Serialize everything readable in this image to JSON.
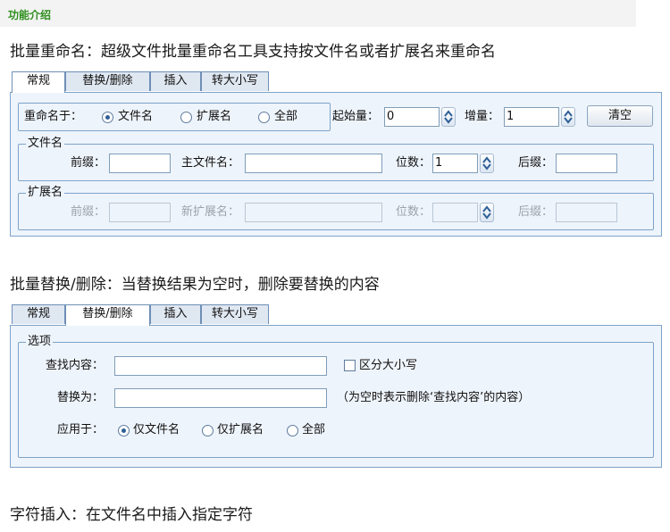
{
  "header": {
    "title": "功能介绍"
  },
  "section1": {
    "description": "批量重命名：超级文件批量重命名工具支持按文件名或者扩展名来重命名",
    "tabs": [
      {
        "label": "常规",
        "active": true
      },
      {
        "label": "替换/删除",
        "active": false
      },
      {
        "label": "插入",
        "active": false
      },
      {
        "label": "转大小写",
        "active": false
      }
    ],
    "rename_on": {
      "label": "重命名于：",
      "options": [
        "文件名",
        "扩展名",
        "全部"
      ],
      "selected": "文件名"
    },
    "start": {
      "label": "起始量：",
      "value": "0"
    },
    "increment": {
      "label": "增量：",
      "value": "1"
    },
    "clear_button": "清空",
    "filename_group": {
      "title": "文件名",
      "prefix_label": "前缀：",
      "prefix_value": "",
      "main_label": "主文件名：",
      "main_value": "",
      "digits_label": "位数：",
      "digits_value": "1",
      "suffix_label": "后缀：",
      "suffix_value": ""
    },
    "ext_group": {
      "title": "扩展名",
      "prefix_label": "前缀：",
      "prefix_value": "",
      "main_label": "新扩展名：",
      "main_value": "",
      "digits_label": "位数：",
      "digits_value": "",
      "suffix_label": "后缀：",
      "suffix_value": ""
    }
  },
  "section2": {
    "description": "批量替换/删除：当替换结果为空时，删除要替换的内容",
    "tabs": [
      {
        "label": "常规",
        "active": false
      },
      {
        "label": "替换/删除",
        "active": true
      },
      {
        "label": "插入",
        "active": false
      },
      {
        "label": "转大小写",
        "active": false
      }
    ],
    "options_group": {
      "title": "选项",
      "find_label": "查找内容：",
      "find_value": "",
      "case_label": "区分大小写",
      "case_checked": false,
      "replace_label": "替换为：",
      "replace_value": "",
      "replace_hint": "（为空时表示删除‘查找内容’的内容）",
      "apply_label": "应用于：",
      "apply_options": [
        "仅文件名",
        "仅扩展名",
        "全部"
      ],
      "apply_selected": "仅文件名"
    }
  },
  "section3": {
    "description": "字符插入：在文件名中插入指定字符"
  },
  "colors": {
    "header_text": "#2f8f1f",
    "panel_bg": "#eef4fb",
    "panel_border": "#7ea3c9",
    "tab_bg": "#dfe7f1"
  },
  "icons": {
    "spinner": "up-down-spinner-icon",
    "radio": "radio-button-icon",
    "checkbox": "checkbox-icon"
  }
}
